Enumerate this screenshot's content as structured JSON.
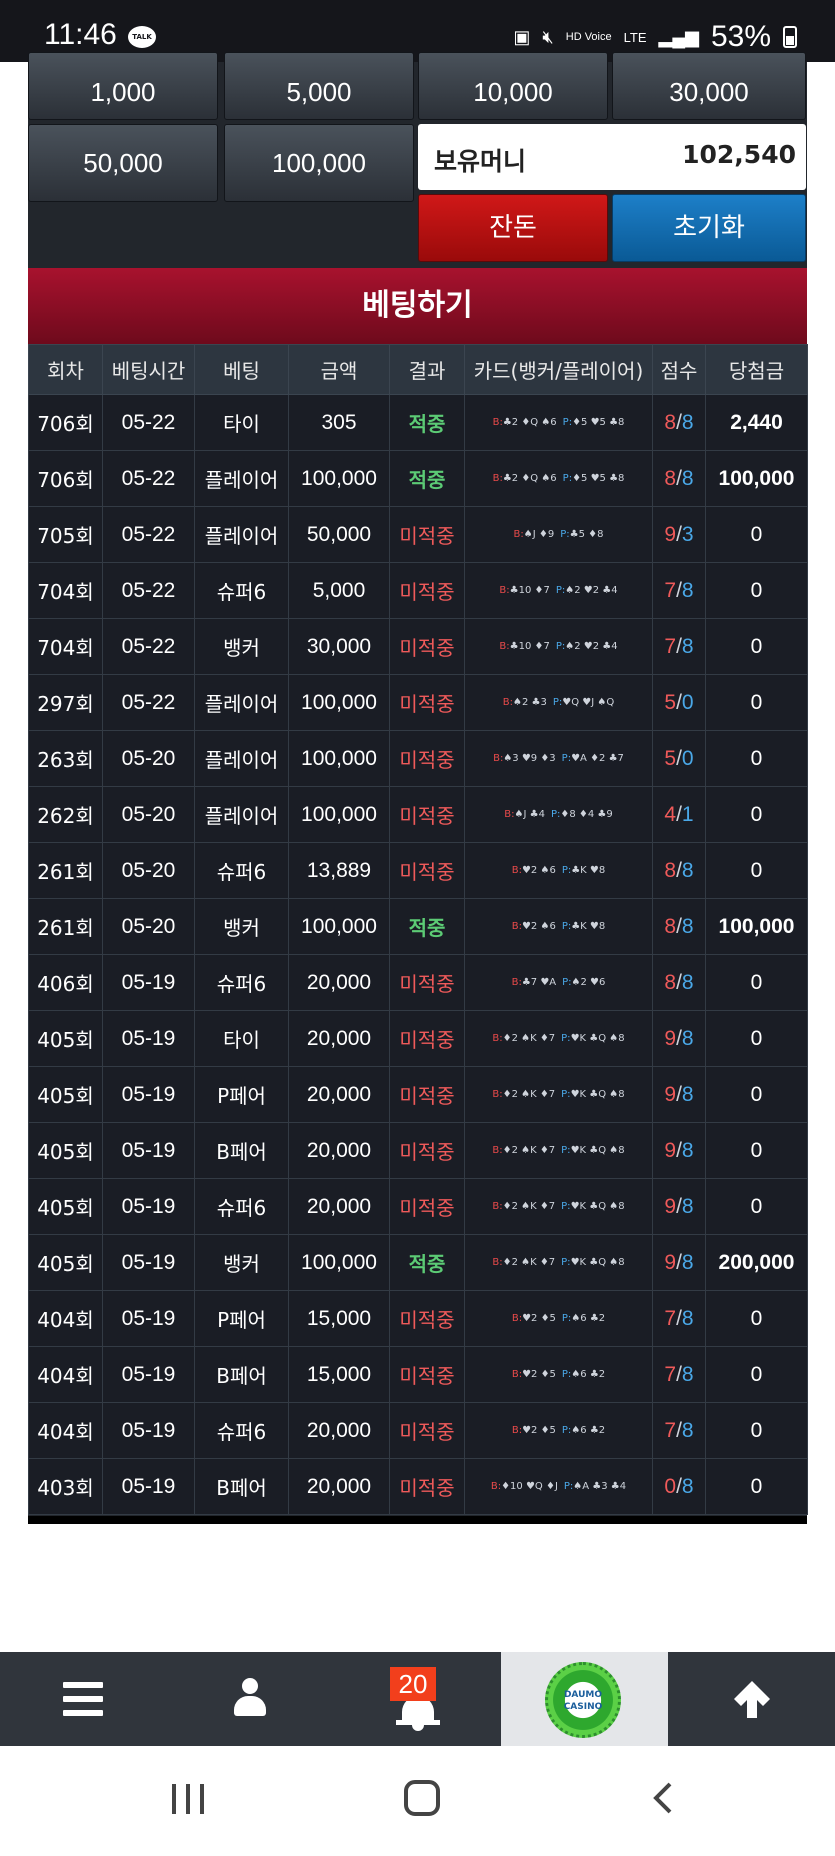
{
  "status_bar": {
    "time": "11:46",
    "talk_label": "TALK",
    "hd_label": "HD Voice",
    "lte_label": "LTE",
    "battery_percent": "53%"
  },
  "amount_buttons": [
    "1,000",
    "5,000",
    "10,000",
    "30,000",
    "50,000",
    "100,000"
  ],
  "holding": {
    "label": "보유머니",
    "value": "102,540"
  },
  "actions": {
    "reset": "잔돈",
    "init": "초기화"
  },
  "bet_title": "베팅하기",
  "table": {
    "headers": [
      "회차",
      "베팅시간",
      "베팅",
      "금액",
      "결과",
      "카드(뱅커/플레이어)",
      "점수",
      "당첨금"
    ],
    "rows": [
      {
        "round": "706회",
        "time": "05-22",
        "bet": "타이",
        "amount": "305",
        "result": "적중",
        "hit": true,
        "banker": "♣2 ♦Q ♠6",
        "player": "♦5 ♥5 ♣8",
        "score_b": "8",
        "score_p": "8",
        "win": "2,440"
      },
      {
        "round": "706회",
        "time": "05-22",
        "bet": "플레이어",
        "amount": "100,000",
        "result": "적중",
        "hit": true,
        "banker": "♣2 ♦Q ♠6",
        "player": "♦5 ♥5 ♣8",
        "score_b": "8",
        "score_p": "8",
        "win": "100,000"
      },
      {
        "round": "705회",
        "time": "05-22",
        "bet": "플레이어",
        "amount": "50,000",
        "result": "미적중",
        "hit": false,
        "banker": "♠J ♦9",
        "player": "♣5 ♦8",
        "score_b": "9",
        "score_p": "3",
        "win": "0"
      },
      {
        "round": "704회",
        "time": "05-22",
        "bet": "슈퍼6",
        "amount": "5,000",
        "result": "미적중",
        "hit": false,
        "banker": "♣10 ♦7",
        "player": "♠2 ♥2 ♣4",
        "score_b": "7",
        "score_p": "8",
        "win": "0"
      },
      {
        "round": "704회",
        "time": "05-22",
        "bet": "뱅커",
        "amount": "30,000",
        "result": "미적중",
        "hit": false,
        "banker": "♣10 ♦7",
        "player": "♠2 ♥2 ♣4",
        "score_b": "7",
        "score_p": "8",
        "win": "0"
      },
      {
        "round": "297회",
        "time": "05-22",
        "bet": "플레이어",
        "amount": "100,000",
        "result": "미적중",
        "hit": false,
        "banker": "♠2 ♣3",
        "player": "♥Q ♥J ♠Q",
        "score_b": "5",
        "score_p": "0",
        "win": "0"
      },
      {
        "round": "263회",
        "time": "05-20",
        "bet": "플레이어",
        "amount": "100,000",
        "result": "미적중",
        "hit": false,
        "banker": "♠3 ♥9 ♦3",
        "player": "♥A ♦2 ♣7",
        "score_b": "5",
        "score_p": "0",
        "win": "0"
      },
      {
        "round": "262회",
        "time": "05-20",
        "bet": "플레이어",
        "amount": "100,000",
        "result": "미적중",
        "hit": false,
        "banker": "♠J ♣4",
        "player": "♦8 ♦4 ♣9",
        "score_b": "4",
        "score_p": "1",
        "win": "0"
      },
      {
        "round": "261회",
        "time": "05-20",
        "bet": "슈퍼6",
        "amount": "13,889",
        "result": "미적중",
        "hit": false,
        "banker": "♥2 ♠6",
        "player": "♣K ♥8",
        "score_b": "8",
        "score_p": "8",
        "win": "0"
      },
      {
        "round": "261회",
        "time": "05-20",
        "bet": "뱅커",
        "amount": "100,000",
        "result": "적중",
        "hit": true,
        "banker": "♥2 ♠6",
        "player": "♣K ♥8",
        "score_b": "8",
        "score_p": "8",
        "win": "100,000"
      },
      {
        "round": "406회",
        "time": "05-19",
        "bet": "슈퍼6",
        "amount": "20,000",
        "result": "미적중",
        "hit": false,
        "banker": "♣7 ♥A",
        "player": "♠2 ♥6",
        "score_b": "8",
        "score_p": "8",
        "win": "0"
      },
      {
        "round": "405회",
        "time": "05-19",
        "bet": "타이",
        "amount": "20,000",
        "result": "미적중",
        "hit": false,
        "banker": "♦2 ♠K ♦7",
        "player": "♥K ♣Q ♠8",
        "score_b": "9",
        "score_p": "8",
        "win": "0"
      },
      {
        "round": "405회",
        "time": "05-19",
        "bet": "P페어",
        "amount": "20,000",
        "result": "미적중",
        "hit": false,
        "banker": "♦2 ♠K ♦7",
        "player": "♥K ♣Q ♠8",
        "score_b": "9",
        "score_p": "8",
        "win": "0"
      },
      {
        "round": "405회",
        "time": "05-19",
        "bet": "B페어",
        "amount": "20,000",
        "result": "미적중",
        "hit": false,
        "banker": "♦2 ♠K ♦7",
        "player": "♥K ♣Q ♠8",
        "score_b": "9",
        "score_p": "8",
        "win": "0"
      },
      {
        "round": "405회",
        "time": "05-19",
        "bet": "슈퍼6",
        "amount": "20,000",
        "result": "미적중",
        "hit": false,
        "banker": "♦2 ♠K ♦7",
        "player": "♥K ♣Q ♠8",
        "score_b": "9",
        "score_p": "8",
        "win": "0"
      },
      {
        "round": "405회",
        "time": "05-19",
        "bet": "뱅커",
        "amount": "100,000",
        "result": "적중",
        "hit": true,
        "banker": "♦2 ♠K ♦7",
        "player": "♥K ♣Q ♠8",
        "score_b": "9",
        "score_p": "8",
        "win": "200,000"
      },
      {
        "round": "404회",
        "time": "05-19",
        "bet": "P페어",
        "amount": "15,000",
        "result": "미적중",
        "hit": false,
        "banker": "♥2 ♦5",
        "player": "♠6 ♣2",
        "score_b": "7",
        "score_p": "8",
        "win": "0"
      },
      {
        "round": "404회",
        "time": "05-19",
        "bet": "B페어",
        "amount": "15,000",
        "result": "미적중",
        "hit": false,
        "banker": "♥2 ♦5",
        "player": "♠6 ♣2",
        "score_b": "7",
        "score_p": "8",
        "win": "0"
      },
      {
        "round": "404회",
        "time": "05-19",
        "bet": "슈퍼6",
        "amount": "20,000",
        "result": "미적중",
        "hit": false,
        "banker": "♥2 ♦5",
        "player": "♠6 ♣2",
        "score_b": "7",
        "score_p": "8",
        "win": "0"
      },
      {
        "round": "403회",
        "time": "05-19",
        "bet": "B페어",
        "amount": "20,000",
        "result": "미적중",
        "hit": false,
        "banker": "♦10 ♥Q ♦J",
        "player": "♠A ♣3 ♣4",
        "score_b": "0",
        "score_p": "8",
        "win": "0"
      }
    ]
  },
  "card_labels": {
    "banker": "B:",
    "player": "P:"
  },
  "bottom_nav": {
    "notification_count": "20",
    "logo_text_1": "DAUMO",
    "logo_text_2": "CASINO",
    "items": [
      "menu-icon",
      "user-icon",
      "bell-icon",
      "logo",
      "arrow-up-icon"
    ]
  }
}
